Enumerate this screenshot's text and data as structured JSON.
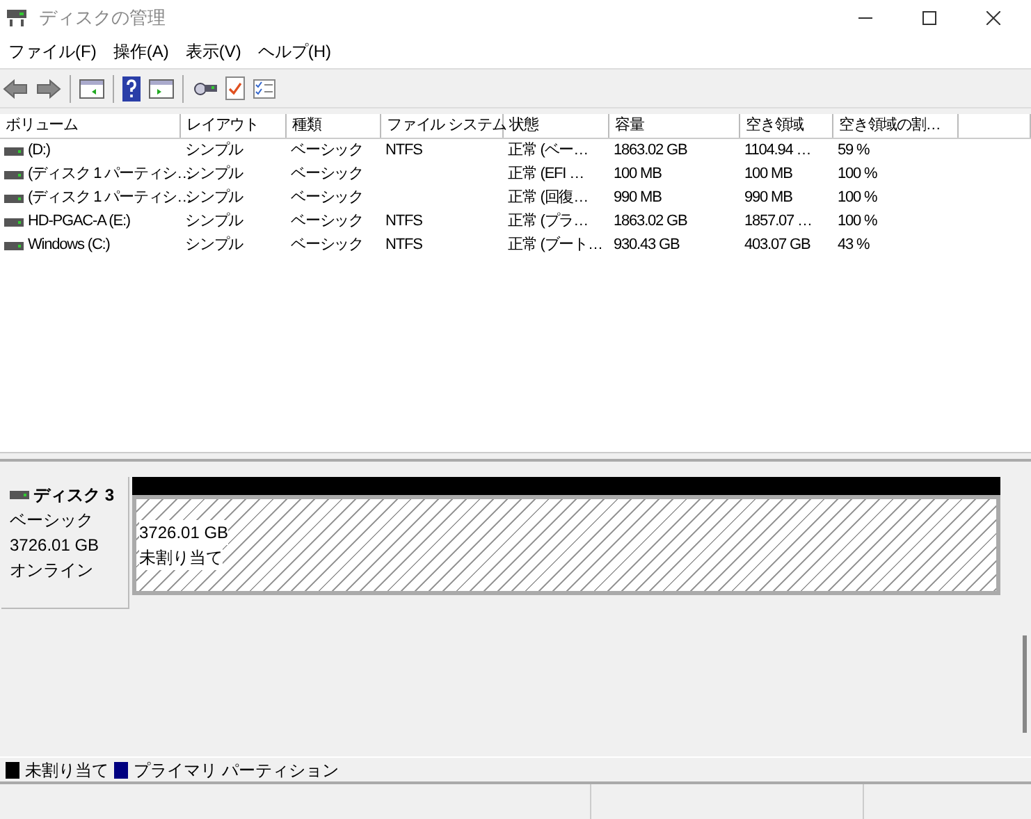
{
  "window": {
    "title": "ディスクの管理"
  },
  "menu": [
    "ファイル(F)",
    "操作(A)",
    "表示(V)",
    "ヘルプ(H)"
  ],
  "volume_table": {
    "columns": [
      "ボリューム",
      "レイアウト",
      "種類",
      "ファイル システム",
      "状態",
      "容量",
      "空き領域",
      "空き領域の割…"
    ],
    "rows": [
      [
        "(D:)",
        "シンプル",
        "ベーシック",
        "NTFS",
        "正常 (ベー…",
        "1863.02 GB",
        "1104.94 …",
        "59 %"
      ],
      [
        "(ディスク 1 パーティシ…",
        "シンプル",
        "ベーシック",
        "",
        "正常 (EFI …",
        "100 MB",
        "100 MB",
        "100 %"
      ],
      [
        "(ディスク 1 パーティシ…",
        "シンプル",
        "ベーシック",
        "",
        "正常 (回復…",
        "990 MB",
        "990 MB",
        "100 %"
      ],
      [
        "HD-PGAC-A (E:)",
        "シンプル",
        "ベーシック",
        "NTFS",
        "正常 (プラ…",
        "1863.02 GB",
        "1857.07 …",
        "100 %"
      ],
      [
        "Windows (C:)",
        "シンプル",
        "ベーシック",
        "NTFS",
        "正常 (ブート…",
        "930.43 GB",
        "403.07 GB",
        "43 %"
      ]
    ]
  },
  "disk": {
    "name": "ディスク 3",
    "type": "ベーシック",
    "size": "3726.01 GB",
    "status": "オンライン",
    "partitions": [
      {
        "size": "3726.01 GB",
        "label": "未割り当て",
        "color": "#000000"
      }
    ]
  },
  "legend": [
    {
      "label": "未割り当て",
      "color": "#000000"
    },
    {
      "label": "プライマリ パーティション",
      "color": "#000080"
    }
  ]
}
